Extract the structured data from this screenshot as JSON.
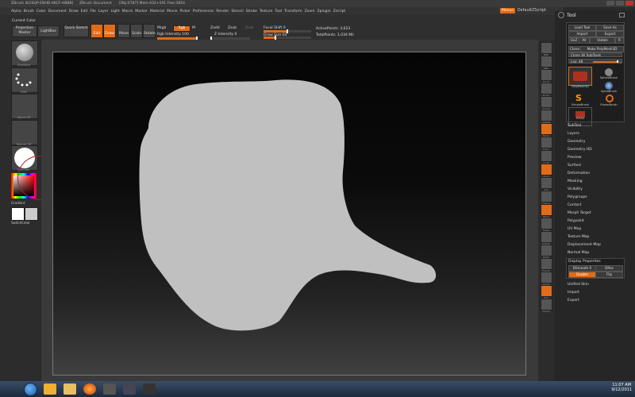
{
  "titlebar": {
    "app": "ZBrush 4[GSQP-ENHD-AKCF-HBBB]",
    "document": "ZBrush Document",
    "stats": "[Obj:6787]   Mem:432+191   Free:3854"
  },
  "menu": [
    "Alpha",
    "Brush",
    "Color",
    "Document",
    "Draw",
    "Edit",
    "File",
    "Layer",
    "Light",
    "Macro",
    "Marker",
    "Material",
    "Movie",
    "Picker",
    "Preferences",
    "Render",
    "Stencil",
    "Stroke",
    "Texture",
    "Tool",
    "Transform",
    "Zoom",
    "Zplugin",
    "Zscript"
  ],
  "menu_right": {
    "menus_btn": "Menus",
    "script": "DefaultZScript"
  },
  "toolbar": {
    "current_color": "Current Color",
    "projection_master": "Projection Master",
    "lightbox": "LightBox",
    "quick_sketch": "Quick Sketch",
    "edit": "Edit",
    "draw": "Draw",
    "move": "Move",
    "scale": "Scale",
    "rotate": "Rotate",
    "mrgb": "Mrgb",
    "rgb": "Rgb",
    "m": "M",
    "rgb_intensity": "Rgb Intensity 100",
    "zadd": "Zadd",
    "zsub": "Zsub",
    "zcut": "Zcut",
    "z_intensity": "Z Intensity 0",
    "focal_shift": "Focal Shift 0",
    "draw_size": "Draw Size 64",
    "active_points": "ActivePoints: 3,623",
    "total_points": "TotalPoints: 1.034 Mil",
    "intensity_levels": {
      "rgb": 1.0,
      "z": 0.0,
      "focal": 0.5,
      "draw": 0.25
    }
  },
  "left_shelf": {
    "standard": "Standard",
    "dots": "Dots",
    "alpha_off": "Alpha Off",
    "texture_off": "Texture Off",
    "flat_color": "FlatColor",
    "gradient": "Gradient",
    "switch_color": "SwitchColor"
  },
  "right_shelf": [
    "BPR",
    "SPix",
    "Scroll",
    "Zoom",
    "Actual",
    "AAHalf",
    "Persp",
    "Floor",
    "Local",
    "LSym",
    "Xyz",
    "Frame",
    "Move",
    "Scale",
    "Rotate",
    "PolyF",
    "Transp",
    "Ghost",
    "Solo",
    "Xpose"
  ],
  "tray": {
    "title": "Tool",
    "load_tool": "Load Tool",
    "save_as": "Save As",
    "import": "Import",
    "export": "Export",
    "goz": "GoZ",
    "all": "All",
    "visible": "Visible",
    "r": "R",
    "clone": "Clone",
    "make_polymesh": "Make PolyMesh3D",
    "clone_all": "Clone All SubTools",
    "lsp_slider": "Lsp: 48",
    "lsp_level": 0.85,
    "thumbs": [
      "PolyMesh3D",
      "SphereBrush",
      "AlphaBrush",
      "SimpleBrush",
      "EraserBrush",
      "PM3D"
    ],
    "items": [
      "SubTool",
      "Layers",
      "Geometry",
      "Geometry HD",
      "Preview",
      "Surface",
      "Deformation",
      "Masking",
      "Visibility",
      "Polygroups",
      "Contact",
      "Morph Target",
      "Polypaint",
      "UV Map",
      "Texture Map",
      "Displacement Map",
      "Normal Map"
    ],
    "display_properties": "Display Properties",
    "dsmooth": "DSmooth 0",
    "dres": "DRes",
    "double": "Double",
    "flip": "Flip",
    "items_after": [
      "Unified Skin",
      "Import",
      "Export"
    ]
  },
  "taskbar": {
    "time": "11:07 AM",
    "date": "9/12/2011"
  },
  "colors": {
    "accent": "#e06b18",
    "mesh": "#c0c0c0"
  }
}
